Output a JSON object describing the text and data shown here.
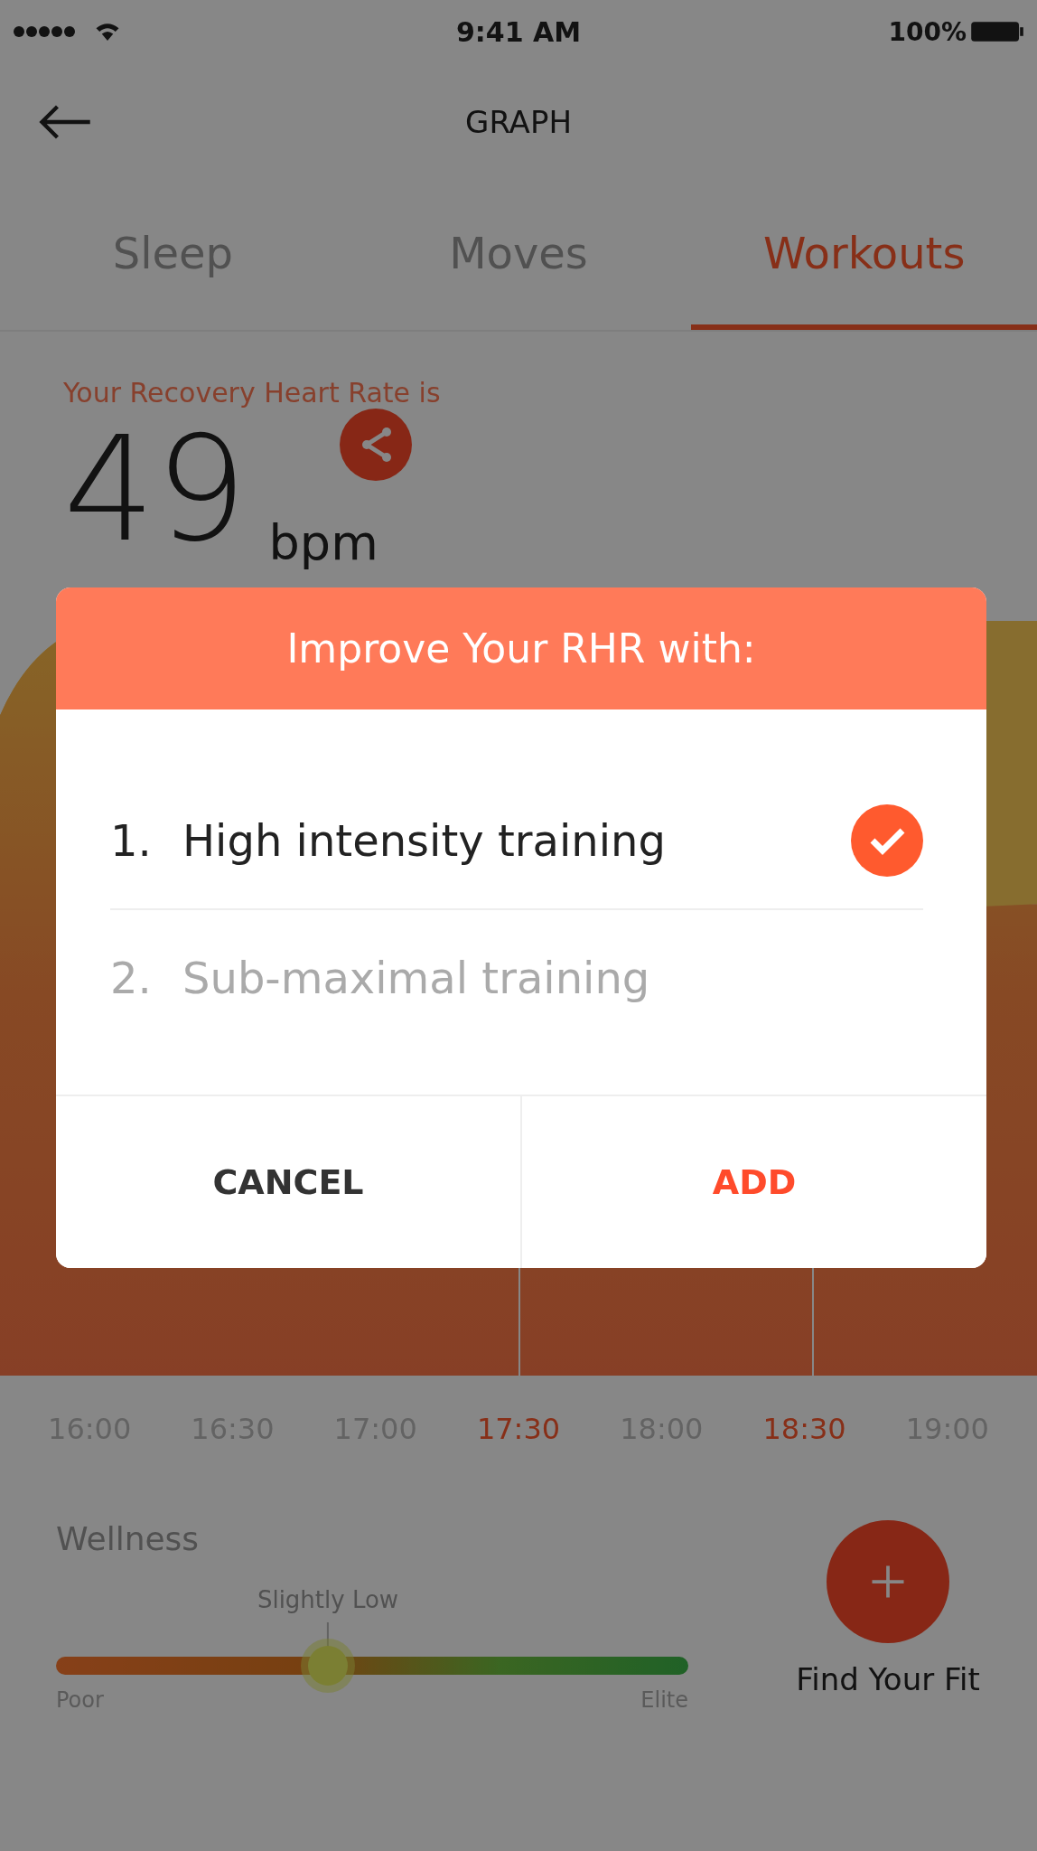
{
  "status_bar": {
    "time": "9:41 AM",
    "battery": "100%"
  },
  "header": {
    "title": "GRAPH"
  },
  "tabs": [
    {
      "label": "Sleep",
      "selected": false
    },
    {
      "label": "Moves",
      "selected": false
    },
    {
      "label": "Workouts",
      "selected": true
    }
  ],
  "recovery": {
    "label": "Your Recovery Heart Rate is",
    "value": "49",
    "unit": "bpm"
  },
  "time_axis": [
    {
      "label": "16:00",
      "highlighted": false
    },
    {
      "label": "16:30",
      "highlighted": false
    },
    {
      "label": "17:00",
      "highlighted": false
    },
    {
      "label": "17:30",
      "highlighted": true
    },
    {
      "label": "18:00",
      "highlighted": false
    },
    {
      "label": "18:30",
      "highlighted": true
    },
    {
      "label": "19:00",
      "highlighted": false
    }
  ],
  "wellness": {
    "title": "Wellness",
    "marker": "Slightly Low",
    "level": 0.43,
    "min_label": "Poor",
    "max_label": "Elite"
  },
  "fab": {
    "label": "Find Your Fit"
  },
  "dialog": {
    "title": "Improve Your RHR with:",
    "options": [
      {
        "number": "1.",
        "label": "High intensity training",
        "selected": true
      },
      {
        "number": "2.",
        "label": "Sub-maximal training",
        "selected": false
      }
    ],
    "buttons": [
      {
        "label": "CANCEL",
        "kind": "secondary"
      },
      {
        "label": "ADD",
        "kind": "primary"
      }
    ]
  }
}
